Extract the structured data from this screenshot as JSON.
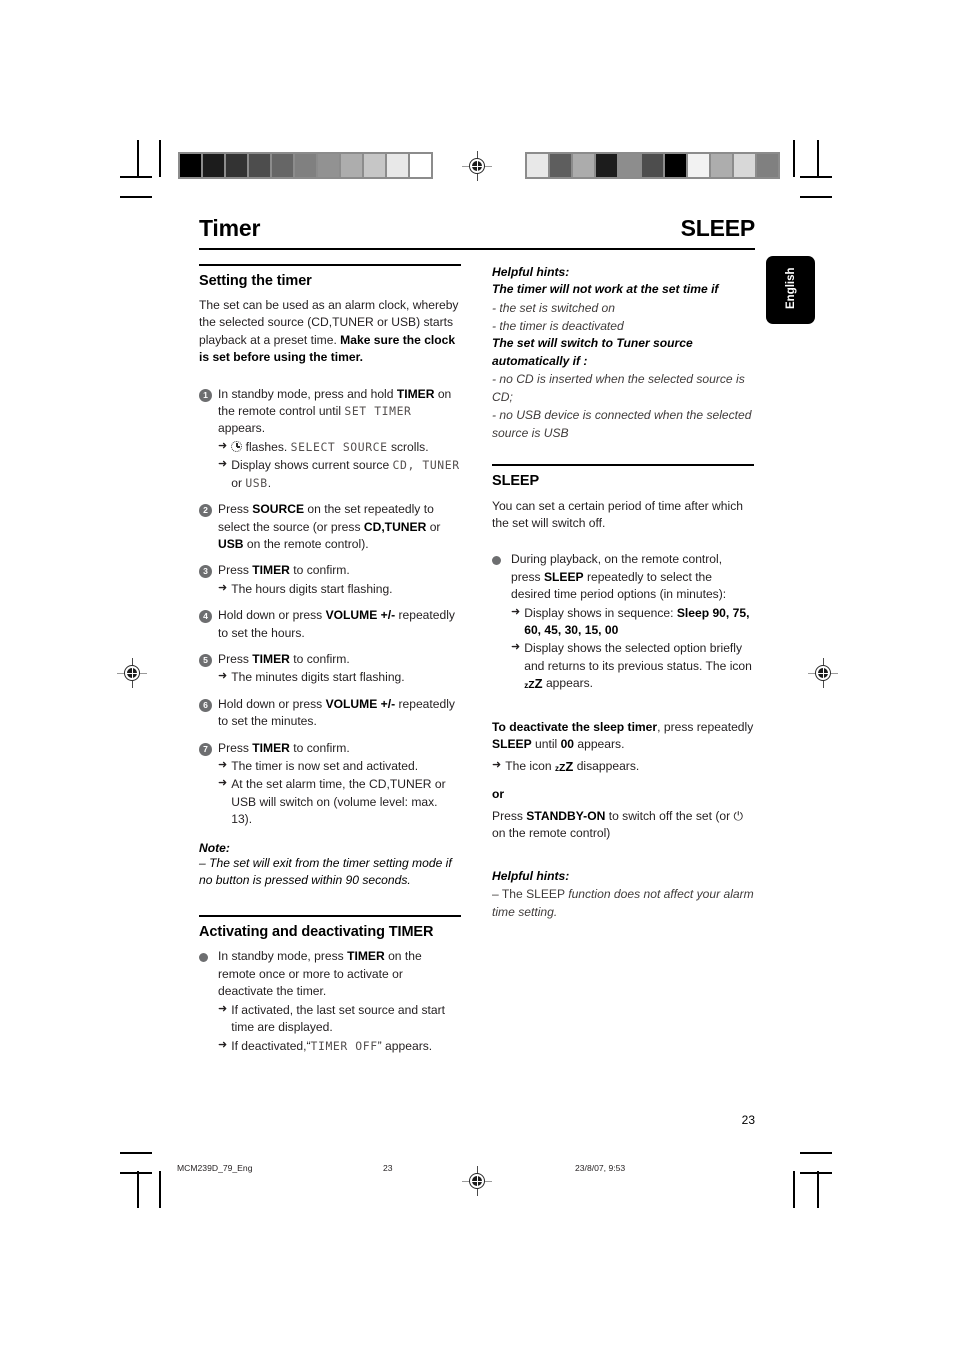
{
  "header": {
    "title_left": "Timer",
    "title_right": "SLEEP"
  },
  "lang_tab": {
    "label": "English"
  },
  "left_column": {
    "section1": {
      "title": "Setting the timer",
      "intro_normal_1": "The set can be used as an alarm clock, whereby the selected source (CD,TUNER or USB) starts playback at a preset time. ",
      "intro_bold": "Make sure the clock is set before using the timer.",
      "steps": [
        {
          "num": "1",
          "text_a": "In standby mode, press and hold ",
          "bold_a": "TIMER",
          "text_b": " on the remote control until ",
          "lcd_a": "SET TIMER",
          "text_c": " appears.",
          "subs": [
            {
              "pre": "",
              "icon": "clock-icon",
              "mid": " flashes. ",
              "lcd": "SELECT SOURCE",
              "post": " scrolls."
            },
            {
              "pre": "Display shows current source ",
              "lcd": "CD, TUNER",
              "post": " or ",
              "lcd2": "USB",
              "post2": "."
            }
          ]
        },
        {
          "num": "2",
          "text_a": "Press ",
          "bold_a": "SOURCE",
          "text_b": " on the set repeatedly to select the source (or press ",
          "bold_b": "CD,TUNER",
          "text_c": " or ",
          "bold_c": "USB",
          "text_d": " on the remote control)."
        },
        {
          "num": "3",
          "text_a": "Press ",
          "bold_a": "TIMER",
          "text_b": " to confirm.",
          "sub_plain": "The hours digits start flashing."
        },
        {
          "num": "4",
          "text_a": "Hold down or press ",
          "bold_a": "VOLUME +/-",
          "text_b": " repeatedly to set the hours."
        },
        {
          "num": "5",
          "text_a": "Press ",
          "bold_a": "TIMER",
          "text_b": " to confirm.",
          "sub_plain": "The minutes digits start flashing."
        },
        {
          "num": "6",
          "text_a": "Hold down or press ",
          "bold_a": "VOLUME +/-",
          "text_b": " repeatedly to set the minutes."
        },
        {
          "num": "7",
          "text_a": "Press ",
          "bold_a": "TIMER",
          "text_b": " to confirm.",
          "sub_plain": "The timer is now set and activated.",
          "sub_plain2": "At the set alarm time, the CD,TUNER or USB will switch on (volume level: max. 13)."
        }
      ],
      "note_head": "Note:",
      "note_text": "–  The set will exit from the timer setting mode if no button is pressed within 90 seconds."
    },
    "section2": {
      "title": "Activating and deactivating TIMER",
      "bullet_a": "In standby mode, press ",
      "bullet_bold": "TIMER",
      "bullet_b": " on the remote once or more to activate or deactivate the timer.",
      "sub1": "If activated, the last set source and start time are displayed.",
      "sub2_pre": "If deactivated,“",
      "sub2_lcd": "TIMER OFF",
      "sub2_post": "” appears."
    }
  },
  "right_column": {
    "hints_top": {
      "head1": "Helpful hints:",
      "head2": "The timer will not work at the set time if",
      "items1": [
        "- the set is switched on",
        "- the timer is deactivated"
      ],
      "head3": "The set will switch to Tuner source automatically if :",
      "items2": [
        "- no CD is inserted when the selected source is CD;",
        "- no USB device is connected when the selected source is USB"
      ]
    },
    "sleep": {
      "title": "SLEEP",
      "intro": "You can set a certain period of time after which the set will switch off.",
      "bullet_a": "During playback, on the remote control, press ",
      "bullet_bold": "SLEEP",
      "bullet_b": " repeatedly to select the desired time period options (in minutes):",
      "sub1_pre": "Display shows in sequence: ",
      "sub1_bold": "Sleep 90,  75, 60, 45, 30, 15, 00",
      "sub2_pre": "Display shows the selected option briefly and returns to its previous status. The icon ",
      "sub2_icon": "zzz-icon",
      "sub2_post": " appears.",
      "deact_bold": "To deactivate the sleep timer",
      "deact_a": ", press repeatedly ",
      "deact_bold2": "SLEEP",
      "deact_b": " until ",
      "deact_bold3": "00",
      "deact_c": " appears.",
      "deact_sub_pre": "The icon ",
      "deact_sub_post": " disappears.",
      "or_label": "or",
      "standby_a": "Press ",
      "standby_bold": "STANDBY-ON",
      "standby_b": " to switch off the set  (or ",
      "standby_icon": "power-icon",
      "standby_c": " on the remote control)",
      "hint_head": "Helpful hints:",
      "hint_text_a": "–  The SLEEP ",
      "hint_text_b": "function does not affect your alarm time setting."
    }
  },
  "page_number": "23",
  "footer": {
    "file": "MCM239D_79_Eng",
    "page": "23",
    "date": "23/8/07, 9:53"
  },
  "gray_strip_left": [
    "#000000",
    "#1c1c1c",
    "#333333",
    "#4d4d4d",
    "#666666",
    "#808080",
    "#929292",
    "#adadad",
    "#c6c6c6",
    "#e8e8e8",
    "#ffffff"
  ],
  "gray_strip_right": [
    "#e8e8e8",
    "#5e5e5e",
    "#acacac",
    "#1c1c1c",
    "#8d8d8d",
    "#4d4d4d",
    "#000000",
    "#f2f2f2",
    "#adadad",
    "#d8d8d8",
    "#808080"
  ]
}
